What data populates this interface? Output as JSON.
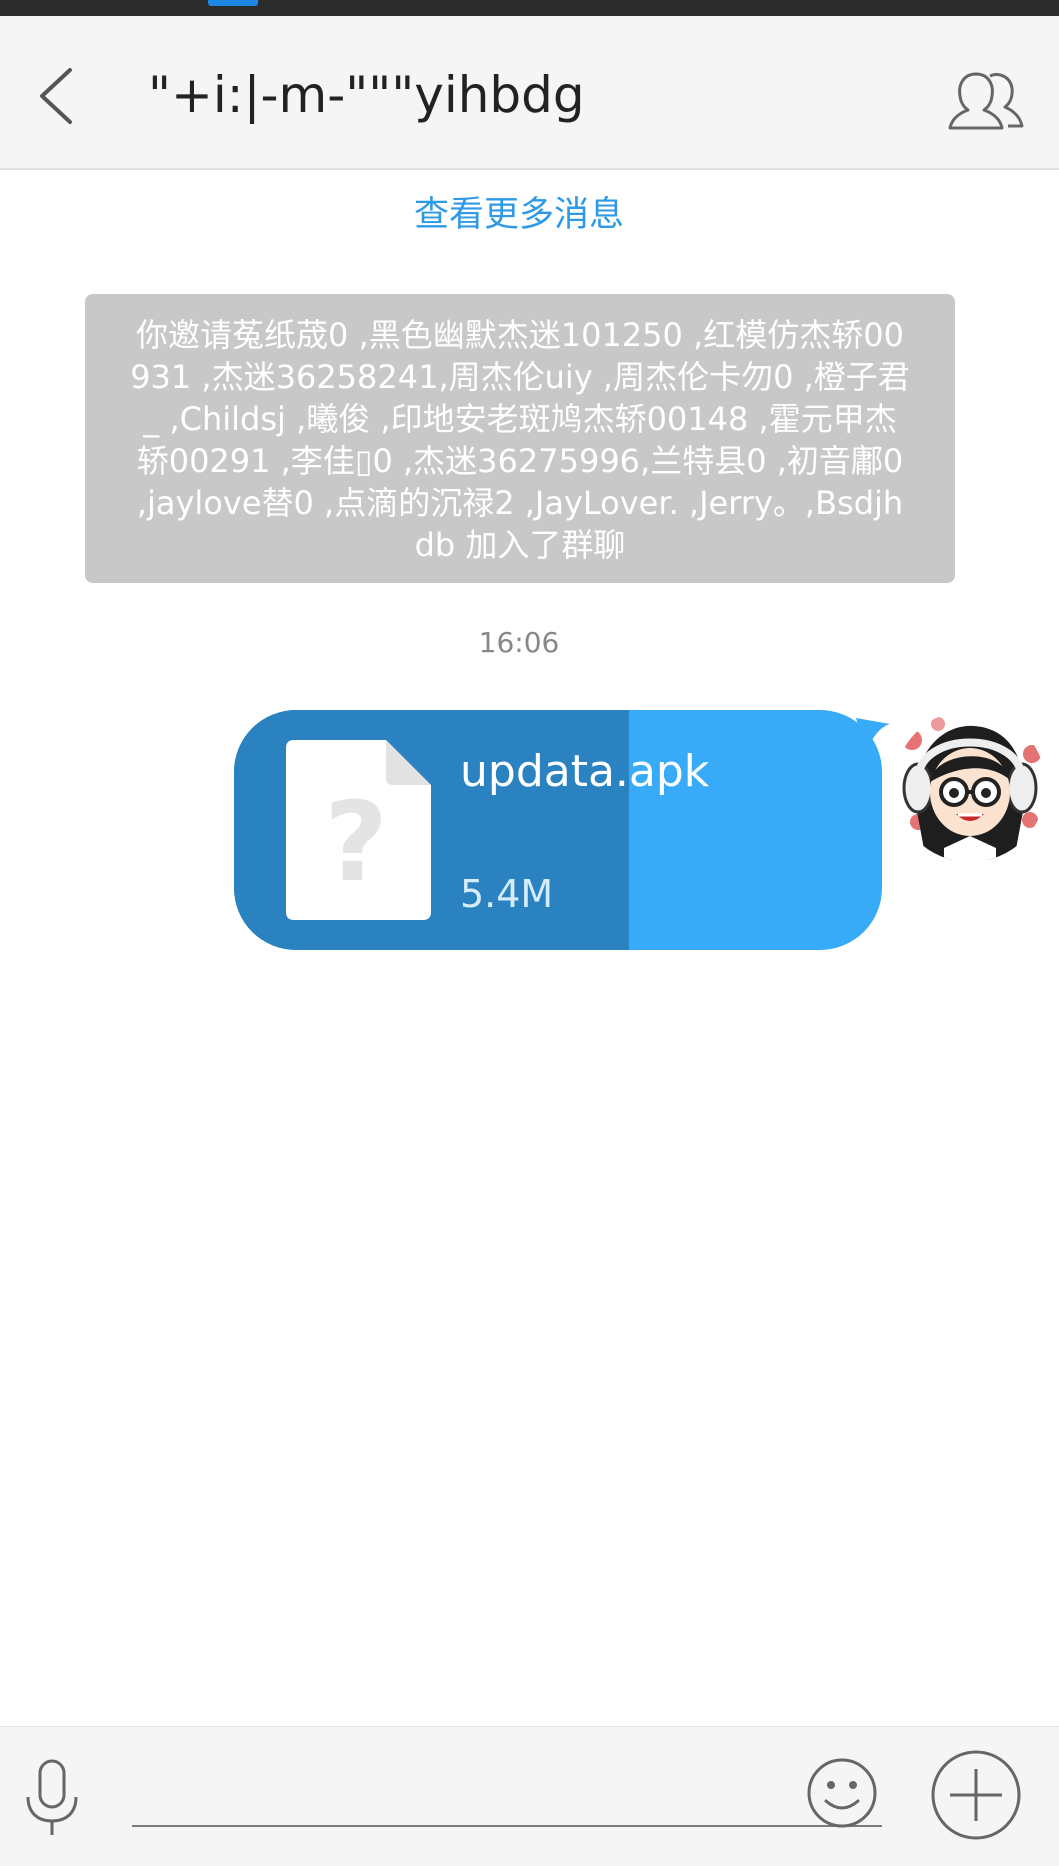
{
  "header": {
    "title": "\"+i:|-m-\"\"\"yihbdg"
  },
  "messages": {
    "load_more": "查看更多消息",
    "system_notice": "你邀请菟纸荿0 ,黑色幽默杰迷101250 ,红模仿杰轿00931 ,杰迷36258241,周杰伦uiy ,周杰伦卡勿0 ,橙子君_ ,Childsj ,曦俊 ,印地安老斑鸠杰轿00148 ,霍元甲杰轿00291 ,李佳▯0 ,杰迷36275996,兰特县0 ,初音鄘0 ,jaylove替0 ,点滴的沉禄2 ,JayLover. ,Jerry。,Bsdjhdb 加入了群聊",
    "timestamp": "16:06",
    "file": {
      "name": "updata.apk",
      "size": "5.4M",
      "upload_progress": 0.61
    }
  },
  "icons": {
    "back": "chevron-left-icon",
    "group": "group-members-icon",
    "file": "unknown-file-icon",
    "voice": "microphone-icon",
    "emoji": "smiley-icon",
    "more": "plus-circle-icon"
  },
  "colors": {
    "accent": "#2e9ae6",
    "bubble": "#38abf8",
    "bubble_progress": "#2a82c0",
    "notice_bg": "#c8c8c8"
  },
  "input": {
    "value": "",
    "placeholder": ""
  }
}
